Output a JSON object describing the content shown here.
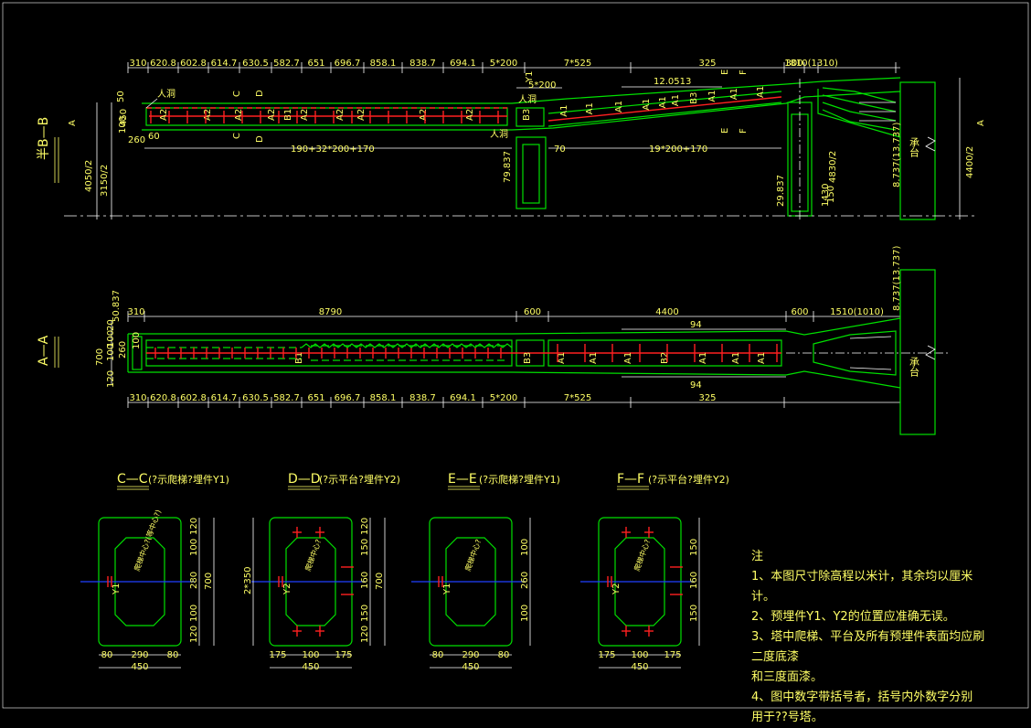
{
  "top_view": {
    "section_label": "半B—B",
    "dims_top": [
      "310",
      "620.8",
      "602.8",
      "614.7",
      "630.5",
      "582.7",
      "651",
      "696.7",
      "858.1",
      "838.7",
      "694.1",
      "5*200",
      "7*525",
      "325",
      "300",
      "1810(1310)"
    ],
    "dim_500": "5*200",
    "elev": "12.0513",
    "span_left": "190+32*200+170",
    "span_right": "19*200+170",
    "span_70": "70",
    "left_vert": [
      "4050/2",
      "3150/2"
    ],
    "left_small": [
      "450",
      "100",
      "260",
      "50",
      "60"
    ],
    "right_vert": [
      "4400/2",
      "4830/2",
      "1430",
      "150",
      "100",
      "50"
    ],
    "elev_right": "8.737(13.737)",
    "elev_mid": "29.837",
    "elev_mid2": "79.837",
    "entrance": "人洞",
    "pier": "承台",
    "segments": [
      "A2",
      "A2",
      "A2",
      "A2",
      "B1",
      "A2",
      "A2",
      "A2",
      "A2",
      "A2",
      "B3",
      "A1",
      "A1",
      "A1",
      "A1",
      "A1",
      "A1",
      "B3",
      "A1",
      "A1",
      "A1"
    ],
    "marks": [
      "C",
      "D",
      "E",
      "F",
      "Y1",
      "A"
    ]
  },
  "plan_view": {
    "section_label": "A—A",
    "dims_top": [
      "310",
      "8790",
      "600",
      "4400",
      "600",
      "1510(1010)"
    ],
    "dims_bottom": [
      "310",
      "620.8",
      "602.8",
      "614.7",
      "630.5",
      "582.7",
      "651",
      "696.7",
      "858.1",
      "838.7",
      "694.1",
      "5*200",
      "7*525",
      "325"
    ],
    "left_small": [
      "50.837",
      "20",
      "100",
      "100",
      "100",
      "260",
      "120",
      "700"
    ],
    "arrow_val": "94",
    "elev_right": "8.737(13.737)",
    "pier": "承台",
    "segments": [
      "B1",
      "B3",
      "A1",
      "A1",
      "A1",
      "B2",
      "A1",
      "A1",
      "A1"
    ]
  },
  "sections": [
    {
      "title": "C—C",
      "subtitle": "(?示爬梯?埋件Y1)",
      "width": "450",
      "sub": [
        "80",
        "290",
        "80"
      ],
      "vert": [
        "120",
        "100",
        "280",
        "100",
        "120"
      ],
      "total": "700",
      "label": "Y1",
      "center_note": "爬梯中心?(等中心?)"
    },
    {
      "title": "D—D",
      "subtitle": "(?示平台?埋件Y2)",
      "width": "450",
      "sub": [
        "175",
        "100",
        "175"
      ],
      "vert": [
        "120",
        "150",
        "160",
        "150",
        "120"
      ],
      "total": "700",
      "left_total": "2*350",
      "label": "Y2",
      "center_note": "爬梯中心?"
    },
    {
      "title": "E—E",
      "subtitle": "(?示爬梯?埋件Y1)",
      "width": "450",
      "sub": [
        "80",
        "290",
        "80"
      ],
      "vert": [
        "100",
        "260",
        "100"
      ],
      "total": "",
      "label": "Y1",
      "center_note": "爬梯中心?"
    },
    {
      "title": "F—F",
      "subtitle": "(?示平台?埋件Y2)",
      "width": "450",
      "sub": [
        "175",
        "100",
        "175"
      ],
      "vert": [
        "150",
        "160",
        "150"
      ],
      "total": "",
      "label": "Y2",
      "center_note": "爬梯中心?"
    }
  ],
  "notes": {
    "title": "注",
    "items": [
      "1、本图尺寸除高程以米计，其余均以厘米",
      "计。",
      "2、预埋件Y1、Y2的位置应准确无误。",
      "3、塔中爬梯、平台及所有预埋件表面均应刷",
      "二度底漆",
      "    和三度面漆。",
      "4、图中数字带括号者，括号内外数字分别",
      "用于??号塔。"
    ]
  },
  "colors": {
    "bg": "#000000",
    "outline": "#00e000",
    "dims": "#ffff66",
    "rebar": "#ff2020",
    "axis": "#2040ff",
    "lines": "#ffffff"
  }
}
